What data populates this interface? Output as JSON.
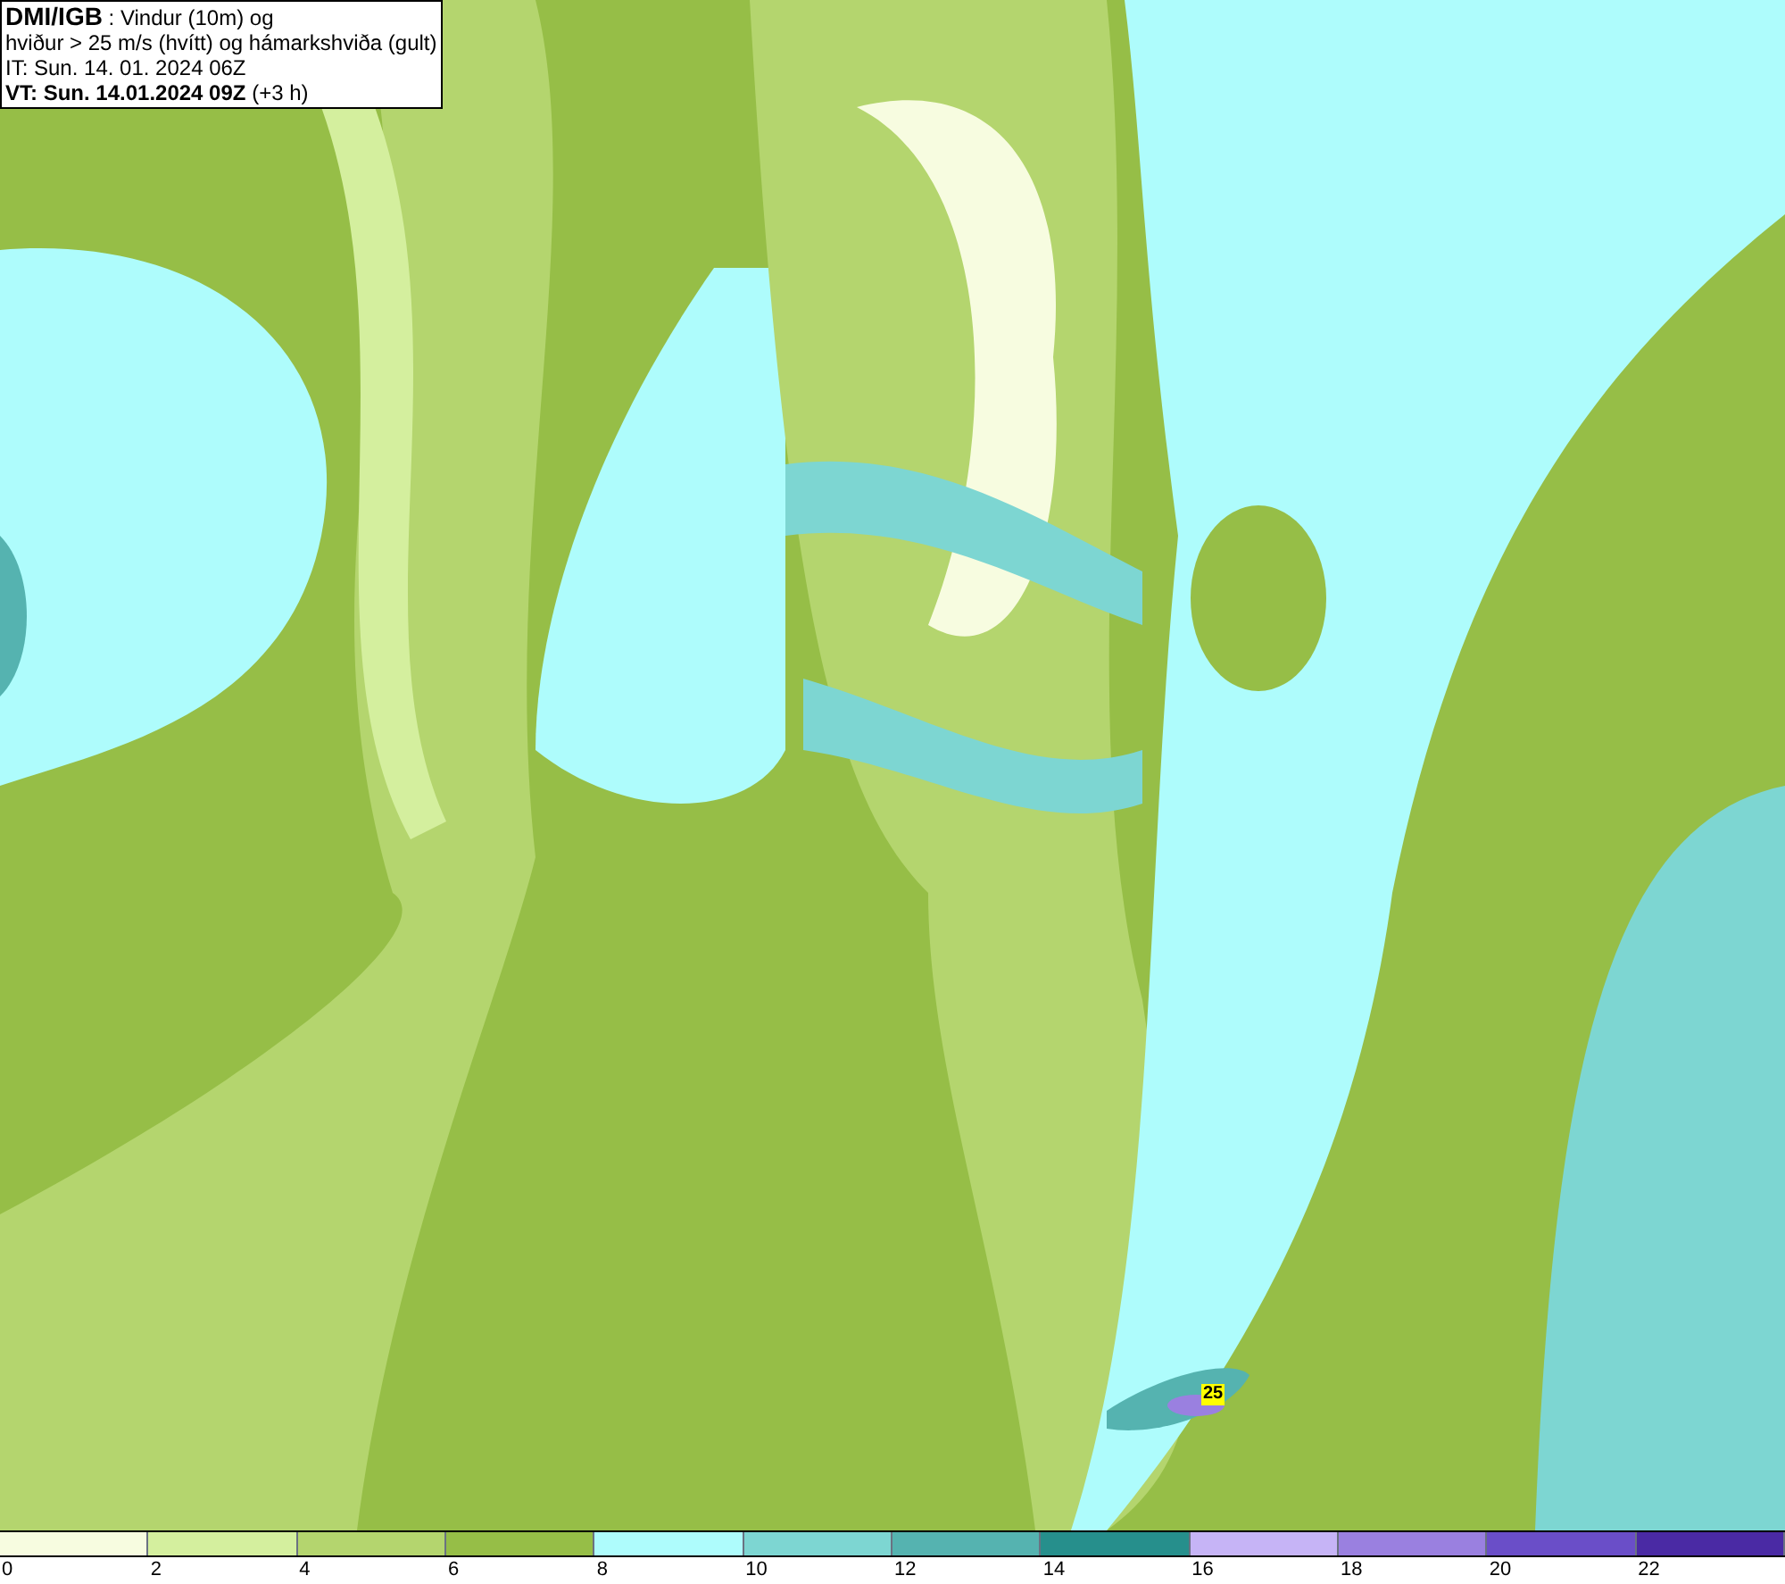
{
  "title_box": {
    "source": "DMI/IGB",
    "description_rest": " : Vindur (10m) og",
    "line_2": "hviður > 25 m/s (hvítt) og hámarkshviða (gult)",
    "initial_time": "IT: Sun. 14. 01. 2024 06Z",
    "valid_time": "VT: Sun. 14.01.2024 09Z",
    "offset": "(+3 h)"
  },
  "map": {
    "gust_markers": [
      {
        "label": "25"
      }
    ]
  },
  "legend": {
    "items": [
      {
        "label": "0",
        "color": "#f7fce0"
      },
      {
        "label": "2",
        "color": "#d4ef9e"
      },
      {
        "label": "4",
        "color": "#b4d56e"
      },
      {
        "label": "6",
        "color": "#96be47"
      },
      {
        "label": "8",
        "color": "#aefcfc"
      },
      {
        "label": "10",
        "color": "#7dd6d2"
      },
      {
        "label": "12",
        "color": "#55b3b0"
      },
      {
        "label": "14",
        "color": "#268f8c"
      },
      {
        "label": "16",
        "color": "#c6b4f6"
      },
      {
        "label": "18",
        "color": "#9a80e0"
      },
      {
        "label": "20",
        "color": "#6a4ec8"
      },
      {
        "label": "22",
        "color": "#4a2aa4"
      }
    ]
  }
}
